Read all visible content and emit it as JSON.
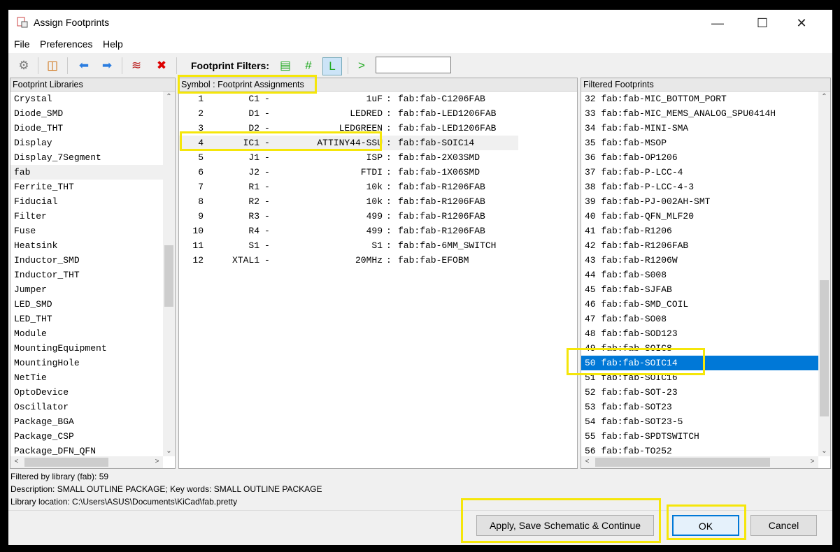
{
  "window": {
    "title": "Assign Footprints"
  },
  "menu": [
    "File",
    "Preferences",
    "Help"
  ],
  "toolbar": {
    "filters_label": "Footprint Filters:",
    "filter_value": ""
  },
  "libraries": {
    "header": "Footprint Libraries",
    "items": [
      "Crystal",
      "Diode_SMD",
      "Diode_THT",
      "Display",
      "Display_7Segment",
      "fab",
      "Ferrite_THT",
      "Fiducial",
      "Filter",
      "Fuse",
      "Heatsink",
      "Inductor_SMD",
      "Inductor_THT",
      "Jumper",
      "LED_SMD",
      "LED_THT",
      "Module",
      "MountingEquipment",
      "MountingHole",
      "NetTie",
      "OptoDevice",
      "Oscillator",
      "Package_BGA",
      "Package_CSP",
      "Package_DFN_QFN"
    ],
    "selected": "fab"
  },
  "assignments": {
    "header": "Symbol : Footprint Assignments",
    "selected_index": 3,
    "rows": [
      {
        "n": "1",
        "ref": "C1",
        "value": "1uF",
        "fp": "fab:fab-C1206FAB"
      },
      {
        "n": "2",
        "ref": "D1",
        "value": "LEDRED",
        "fp": "fab:fab-LED1206FAB"
      },
      {
        "n": "3",
        "ref": "D2",
        "value": "LEDGREEN",
        "fp": "fab:fab-LED1206FAB"
      },
      {
        "n": "4",
        "ref": "IC1",
        "value": "ATTINY44-SSU",
        "fp": "fab:fab-SOIC14"
      },
      {
        "n": "5",
        "ref": "J1",
        "value": "ISP",
        "fp": "fab:fab-2X03SMD"
      },
      {
        "n": "6",
        "ref": "J2",
        "value": "FTDI",
        "fp": "fab:fab-1X06SMD"
      },
      {
        "n": "7",
        "ref": "R1",
        "value": "10k",
        "fp": "fab:fab-R1206FAB"
      },
      {
        "n": "8",
        "ref": "R2",
        "value": "10k",
        "fp": "fab:fab-R1206FAB"
      },
      {
        "n": "9",
        "ref": "R3",
        "value": "499",
        "fp": "fab:fab-R1206FAB"
      },
      {
        "n": "10",
        "ref": "R4",
        "value": "499",
        "fp": "fab:fab-R1206FAB"
      },
      {
        "n": "11",
        "ref": "S1",
        "value": "S1",
        "fp": "fab:fab-6MM_SWITCH"
      },
      {
        "n": "12",
        "ref": "XTAL1",
        "value": "20MHz",
        "fp": "fab:fab-EFOBM"
      }
    ]
  },
  "footprints": {
    "header": "Filtered Footprints",
    "selected": "50 fab:fab-SOIC14",
    "items": [
      "32 fab:fab-MIC_BOTTOM_PORT",
      "33 fab:fab-MIC_MEMS_ANALOG_SPU0414H",
      "34 fab:fab-MINI-SMA",
      "35 fab:fab-MSOP",
      "36 fab:fab-OP1206",
      "37 fab:fab-P-LCC-4",
      "38 fab:fab-P-LCC-4-3",
      "39 fab:fab-PJ-002AH-SMT",
      "40 fab:fab-QFN_MLF20",
      "41 fab:fab-R1206",
      "42 fab:fab-R1206FAB",
      "43 fab:fab-R1206W",
      "44 fab:fab-S008",
      "45 fab:fab-SJFAB",
      "46 fab:fab-SMD_COIL",
      "47 fab:fab-SO08",
      "48 fab:fab-SOD123",
      "49 fab:fab-SOIC8",
      "50 fab:fab-SOIC14",
      "51 fab:fab-SOIC16",
      "52 fab:fab-SOT-23",
      "53 fab:fab-SOT23",
      "54 fab:fab-SOT23-5",
      "55 fab:fab-SPDTSWITCH",
      "56 fab:fab-TO252"
    ]
  },
  "status": {
    "line1": "Filtered by library (fab): 59",
    "line2": "Description: SMALL OUTLINE PACKAGE;  Key words: SMALL OUTLINE PACKAGE",
    "line3": "Library location: C:\\Users\\ASUS\\Documents\\KiCad\\fab.pretty"
  },
  "buttons": {
    "apply": "Apply, Save Schematic & Continue",
    "ok": "OK",
    "cancel": "Cancel"
  },
  "colors": {
    "selection": "#0078d7",
    "highlight": "#f5e60a"
  }
}
